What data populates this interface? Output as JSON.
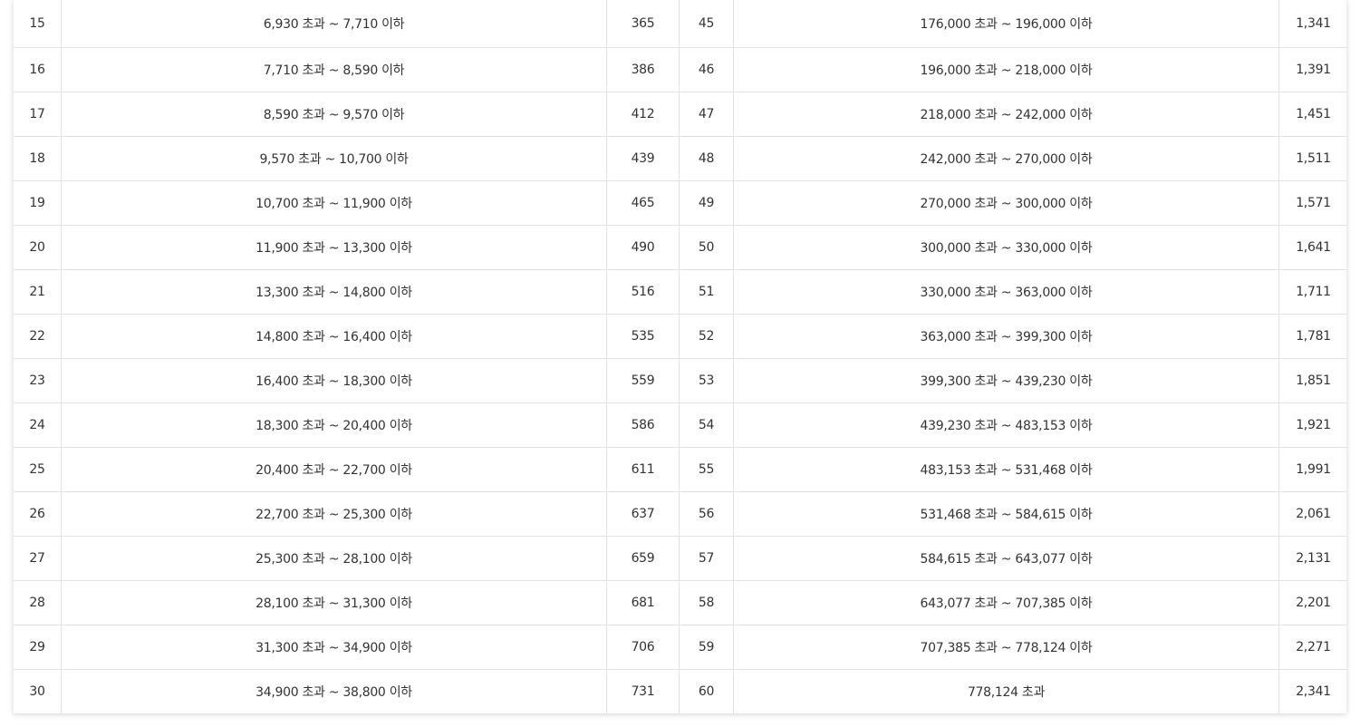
{
  "table": {
    "rows": [
      {
        "g1": "15",
        "r1": "6,930 초과 ~ 7,710 이하",
        "p1": "365",
        "g2": "45",
        "r2": "176,000 초과 ~ 196,000 이하",
        "p2": "1,341"
      },
      {
        "g1": "16",
        "r1": "7,710 초과 ~ 8,590 이하",
        "p1": "386",
        "g2": "46",
        "r2": "196,000 초과 ~ 218,000 이하",
        "p2": "1,391"
      },
      {
        "g1": "17",
        "r1": "8,590 초과 ~ 9,570 이하",
        "p1": "412",
        "g2": "47",
        "r2": "218,000 초과 ~ 242,000 이하",
        "p2": "1,451"
      },
      {
        "g1": "18",
        "r1": "9,570 초과 ~ 10,700 이하",
        "p1": "439",
        "g2": "48",
        "r2": "242,000 초과 ~ 270,000 이하",
        "p2": "1,511"
      },
      {
        "g1": "19",
        "r1": "10,700 초과 ~ 11,900 이하",
        "p1": "465",
        "g2": "49",
        "r2": "270,000 초과 ~ 300,000 이하",
        "p2": "1,571"
      },
      {
        "g1": "20",
        "r1": "11,900 초과 ~ 13,300 이하",
        "p1": "490",
        "g2": "50",
        "r2": "300,000 초과 ~ 330,000 이하",
        "p2": "1,641"
      },
      {
        "g1": "21",
        "r1": "13,300 초과 ~ 14,800 이하",
        "p1": "516",
        "g2": "51",
        "r2": "330,000 초과 ~ 363,000 이하",
        "p2": "1,711"
      },
      {
        "g1": "22",
        "r1": "14,800 초과 ~ 16,400 이하",
        "p1": "535",
        "g2": "52",
        "r2": "363,000 초과 ~ 399,300 이하",
        "p2": "1,781"
      },
      {
        "g1": "23",
        "r1": "16,400 초과 ~ 18,300 이하",
        "p1": "559",
        "g2": "53",
        "r2": "399,300 초과 ~ 439,230 이하",
        "p2": "1,851"
      },
      {
        "g1": "24",
        "r1": "18,300 초과 ~ 20,400 이하",
        "p1": "586",
        "g2": "54",
        "r2": "439,230 초과 ~ 483,153 이하",
        "p2": "1,921"
      },
      {
        "g1": "25",
        "r1": "20,400 초과 ~ 22,700 이하",
        "p1": "611",
        "g2": "55",
        "r2": "483,153 초과 ~ 531,468 이하",
        "p2": "1,991"
      },
      {
        "g1": "26",
        "r1": "22,700 초과 ~ 25,300 이하",
        "p1": "637",
        "g2": "56",
        "r2": "531,468 초과 ~ 584,615 이하",
        "p2": "2,061"
      },
      {
        "g1": "27",
        "r1": "25,300 초과 ~ 28,100 이하",
        "p1": "659",
        "g2": "57",
        "r2": "584,615 초과 ~ 643,077 이하",
        "p2": "2,131"
      },
      {
        "g1": "28",
        "r1": "28,100 초과 ~ 31,300 이하",
        "p1": "681",
        "g2": "58",
        "r2": "643,077 초과 ~ 707,385 이하",
        "p2": "2,201"
      },
      {
        "g1": "29",
        "r1": "31,300 초과 ~ 34,900 이하",
        "p1": "706",
        "g2": "59",
        "r2": "707,385 초과 ~ 778,124 이하",
        "p2": "2,271"
      },
      {
        "g1": "30",
        "r1": "34,900 초과 ~ 38,800 이하",
        "p1": "731",
        "g2": "60",
        "r2": "778,124 초과",
        "p2": "2,341"
      }
    ]
  }
}
